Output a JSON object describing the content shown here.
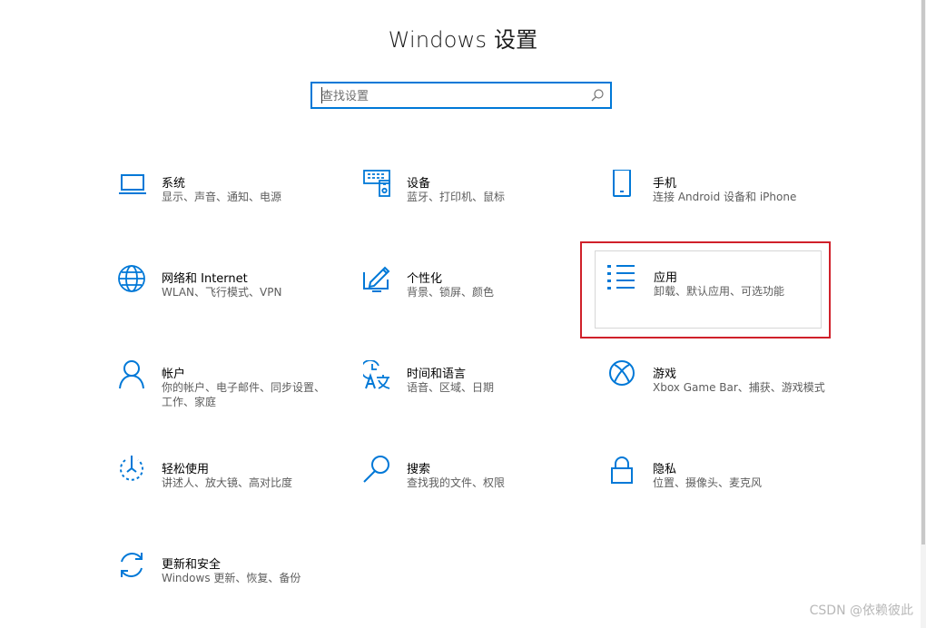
{
  "header": {
    "title": "Windows 设置"
  },
  "search": {
    "placeholder": "查找设置"
  },
  "tiles": [
    {
      "title": "系统",
      "desc": "显示、声音、通知、电源",
      "icon": "laptop-icon"
    },
    {
      "title": "设备",
      "desc": "蓝牙、打印机、鼠标",
      "icon": "devices-icon"
    },
    {
      "title": "手机",
      "desc": "连接 Android 设备和 iPhone",
      "icon": "phone-icon"
    },
    {
      "title": "网络和 Internet",
      "desc": "WLAN、飞行模式、VPN",
      "icon": "globe-icon"
    },
    {
      "title": "个性化",
      "desc": "背景、锁屏、颜色",
      "icon": "personalization-icon"
    },
    {
      "title": "应用",
      "desc": "卸载、默认应用、可选功能",
      "icon": "apps-list-icon",
      "selected": true
    },
    {
      "title": "帐户",
      "desc": "你的帐户、电子邮件、同步设置、工作、家庭",
      "icon": "person-icon"
    },
    {
      "title": "时间和语言",
      "desc": "语音、区域、日期",
      "icon": "time-language-icon"
    },
    {
      "title": "游戏",
      "desc": "Xbox Game Bar、捕获、游戏模式",
      "icon": "xbox-icon"
    },
    {
      "title": "轻松使用",
      "desc": "讲述人、放大镜、高对比度",
      "icon": "ease-of-access-icon"
    },
    {
      "title": "搜索",
      "desc": "查找我的文件、权限",
      "icon": "search-icon"
    },
    {
      "title": "隐私",
      "desc": "位置、摄像头、麦克风",
      "icon": "lock-icon"
    },
    {
      "title": "更新和安全",
      "desc": "Windows 更新、恢复、备份",
      "icon": "sync-icon"
    }
  ],
  "watermark": "CSDN @依赖彼此",
  "colors": {
    "accent": "#0078d7",
    "highlight": "#d0202a"
  }
}
